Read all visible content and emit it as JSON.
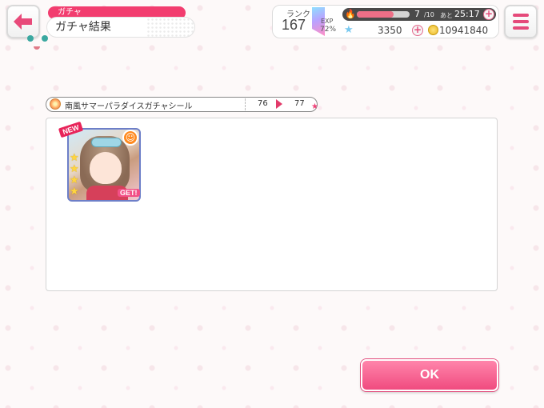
{
  "header": {
    "category": "ガチャ",
    "title": "ガチャ結果"
  },
  "status": {
    "rank_label": "ランク",
    "rank_value": "167",
    "exp_label": "EXP",
    "exp_percent": "72%",
    "stamina_current": "7",
    "stamina_max": "/10",
    "stamina_fill_fraction": 0.7,
    "stamina_time_label": "あと",
    "stamina_time": "25:17",
    "stars": "3350",
    "coins": "10941840"
  },
  "gacha": {
    "name": "南風サマーパラダイスガチャシール",
    "count_before": "76",
    "count_after": "77"
  },
  "result_card": {
    "new_label": "NEW",
    "get_label": "GET!",
    "rarity_stars": 4,
    "attribute_icon": "smile-icon"
  },
  "ok_button": {
    "label": "OK"
  },
  "colors": {
    "accent": "#f23d6f",
    "ok_button": "#f04b7f",
    "card_frame": "#6d7fc8"
  }
}
